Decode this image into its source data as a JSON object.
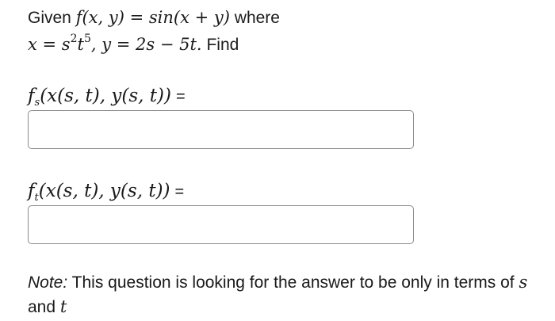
{
  "question": {
    "given_word": "Given",
    "f_def": "f(x, y) = sin(x + y)",
    "where_word": "where",
    "x_def_base": "x = s",
    "x_def_exp1": "2",
    "x_def_t": "t",
    "x_def_exp2": "5",
    "y_def": ", y = 2s − 5t.",
    "find_word": "Find"
  },
  "answers": [
    {
      "label_f": "f",
      "label_sub": "s",
      "label_args": "(x(s, t), y(s, t))",
      "equals": "=",
      "value": "",
      "placeholder": ""
    },
    {
      "label_f": "f",
      "label_sub": "t",
      "label_args": "(x(s, t), y(s, t))",
      "equals": "=",
      "value": "",
      "placeholder": ""
    }
  ],
  "note": {
    "prefix": "Note:",
    "text": "This question is looking for the answer to be only in terms of",
    "var_s": "s",
    "and_word": "and",
    "var_t": "t"
  }
}
